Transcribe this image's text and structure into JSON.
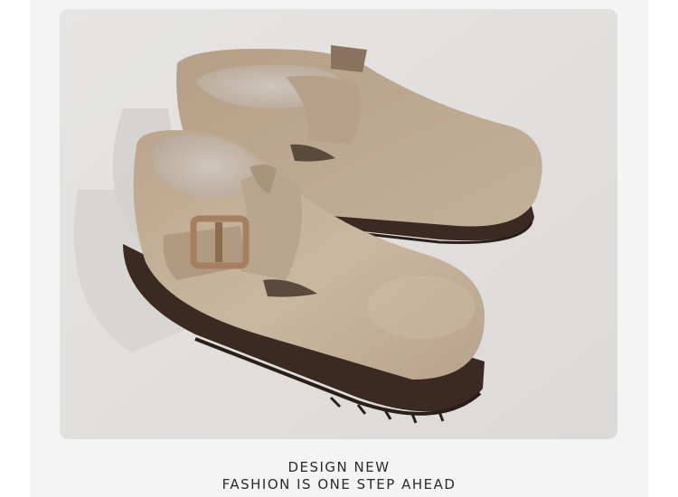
{
  "caption": {
    "line1": "DESIGN NEW",
    "line2": "FASHION IS ONE STEP AHEAD"
  },
  "colors": {
    "background": "#ffffff",
    "card": "#f4f4f4",
    "photo_backdrop": "#e3e2e1",
    "suede": "#c7b39c",
    "suede_shadow": "#a8937b",
    "sole": "#3a2a22",
    "buckle": "#a57f60",
    "text": "#2b2b2b"
  },
  "photo": {
    "subject": "pair-of-suede-buckle-clogs"
  }
}
